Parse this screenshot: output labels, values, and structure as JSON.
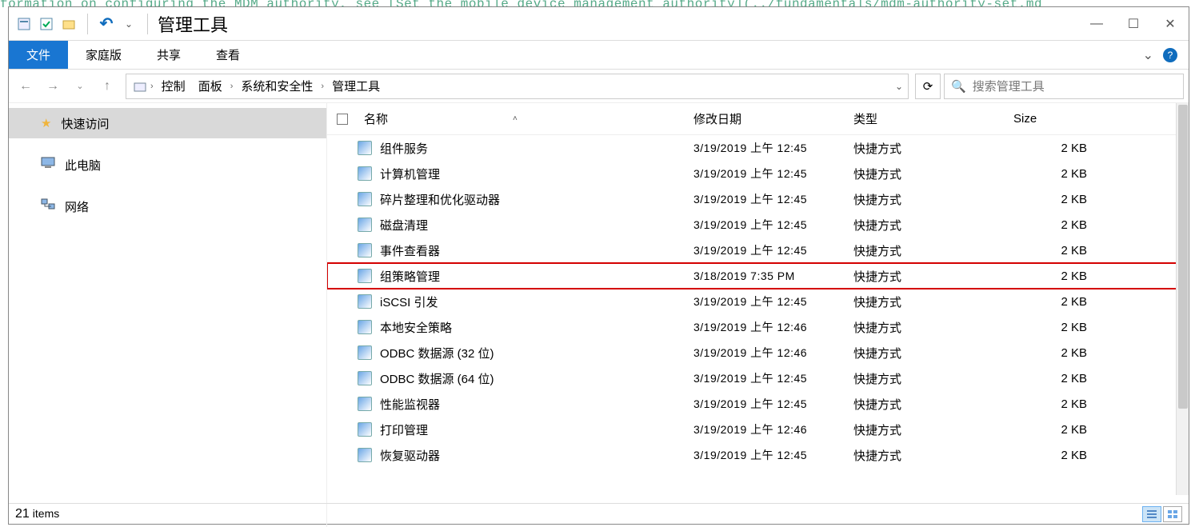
{
  "window": {
    "title": "管理工具",
    "qat": {
      "undo_glyph": "↶",
      "dd_glyph": "⌄"
    }
  },
  "ribbon": {
    "file": "文件",
    "tabs": [
      "家庭版",
      "共享",
      "查看"
    ]
  },
  "nav": {
    "back": "←",
    "fwd": "→",
    "up": "↑",
    "breadcrumb": [
      {
        "label": "控制"
      },
      {
        "label": "面板"
      },
      {
        "label": "系统和安全性"
      },
      {
        "label": "管理工具"
      }
    ],
    "refresh": "⟳",
    "search_placeholder": "搜索管理工具"
  },
  "tree": {
    "items": [
      {
        "label": "快速访问",
        "sel": true
      },
      {
        "label": "此电脑",
        "sel": false
      },
      {
        "label": "网络",
        "sel": false
      }
    ]
  },
  "columns": {
    "name": "名称",
    "date": "修改日期",
    "type": "类型",
    "size": "Size"
  },
  "files": [
    {
      "name": "组件服务",
      "date": "3/19/2019 上午 12:45",
      "type": "快捷方式",
      "size": "2 KB",
      "hl": false
    },
    {
      "name": "计算机管理",
      "date": "3/19/2019 上午 12:45",
      "type": "快捷方式",
      "size": "2 KB",
      "hl": false
    },
    {
      "name": "碎片整理和优化驱动器",
      "date": "3/19/2019 上午 12:45",
      "type": "快捷方式",
      "size": "2 KB",
      "hl": false
    },
    {
      "name": "磁盘清理",
      "date": "3/19/2019 上午 12:45",
      "type": "快捷方式",
      "size": "2 KB",
      "hl": false
    },
    {
      "name": "事件查看器",
      "date": "3/19/2019 上午 12:45",
      "type": "快捷方式",
      "size": "2 KB",
      "hl": false
    },
    {
      "name": "组策略管理",
      "date": "3/18/2019 7:35 PM",
      "type": "快捷方式",
      "size": "2 KB",
      "hl": true
    },
    {
      "name": "iSCSI 引发",
      "date": "3/19/2019 上午 12:45",
      "type": "快捷方式",
      "size": "2 KB",
      "hl": false
    },
    {
      "name": "本地安全策略",
      "date": "3/19/2019 上午 12:46",
      "type": "快捷方式",
      "size": "2 KB",
      "hl": false
    },
    {
      "name": "ODBC 数据源 (32 位)",
      "date": "3/19/2019 上午 12:46",
      "type": "快捷方式",
      "size": "2 KB",
      "hl": false
    },
    {
      "name": "ODBC 数据源 (64 位)",
      "date": "3/19/2019 上午 12:45",
      "type": "快捷方式",
      "size": "2 KB",
      "hl": false
    },
    {
      "name": "性能监视器",
      "date": "3/19/2019 上午 12:45",
      "type": "快捷方式",
      "size": "2 KB",
      "hl": false
    },
    {
      "name": "打印管理",
      "date": "3/19/2019 上午 12:46",
      "type": "快捷方式",
      "size": "2 KB",
      "hl": false
    },
    {
      "name": "恢复驱动器",
      "date": "3/19/2019 上午 12:45",
      "type": "快捷方式",
      "size": "2 KB",
      "hl": false
    }
  ],
  "status": {
    "count": "21",
    "label": "items"
  },
  "bg": "formation on configuring the MDM authority, see [Set the mobile device management authority](../fundamentals/mdm-authority-set.md"
}
